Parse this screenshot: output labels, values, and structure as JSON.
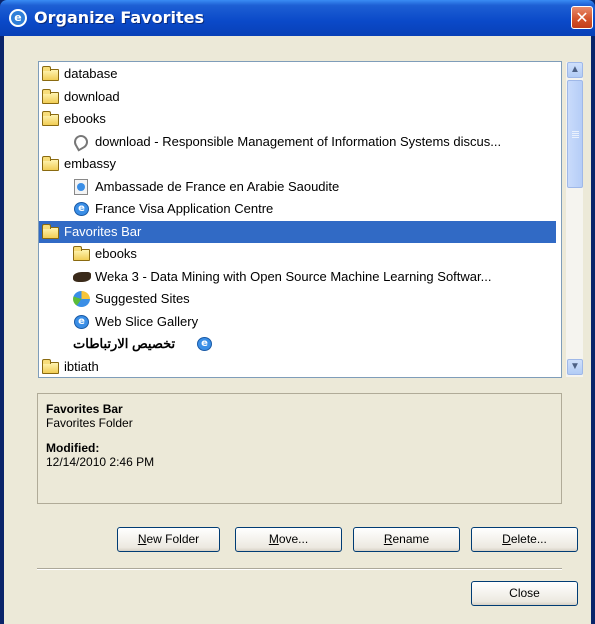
{
  "window": {
    "title": "Organize Favorites",
    "close_glyph": "✕"
  },
  "tree": {
    "items": [
      {
        "label": "database",
        "icon": "folder-icon",
        "indent": 0
      },
      {
        "label": "download",
        "icon": "folder-icon",
        "indent": 0
      },
      {
        "label": "ebooks",
        "icon": "folder-icon",
        "indent": 0
      },
      {
        "label": "download - Responsible Management of Information Systems discus...",
        "icon": "clip-icon",
        "indent": 1
      },
      {
        "label": "embassy",
        "icon": "folder-icon",
        "indent": 0
      },
      {
        "label": "Ambassade de France en Arabie Saoudite",
        "icon": "page-icon",
        "indent": 1
      },
      {
        "label": "France Visa Application Centre",
        "icon": "ie-icon",
        "indent": 1
      },
      {
        "label": "Favorites Bar",
        "icon": "folder-icon",
        "indent": 0,
        "selected": true
      },
      {
        "label": "ebooks",
        "icon": "folder-icon",
        "indent": 1
      },
      {
        "label": "Weka 3 - Data Mining with Open Source Machine Learning Softwar...",
        "icon": "bird-icon",
        "indent": 1
      },
      {
        "label": "Suggested Sites",
        "icon": "suggested-sites-icon",
        "indent": 1
      },
      {
        "label": "Web Slice Gallery",
        "icon": "ie-icon",
        "indent": 1
      },
      {
        "label": "تخصيص الارتباطات",
        "icon": "ie-icon",
        "indent": 1,
        "rtl": true
      },
      {
        "label": "ibtiath",
        "icon": "folder-icon",
        "indent": 0
      }
    ]
  },
  "scrollbar": {
    "up_glyph": "▲",
    "down_glyph": "▼"
  },
  "details": {
    "name": "Favorites Bar",
    "type": "Favorites Folder",
    "modified_label": "Modified:",
    "modified_value": "12/14/2010 2:46 PM"
  },
  "buttons": {
    "new_folder": {
      "accel": "N",
      "rest": "ew Folder"
    },
    "move": {
      "accel": "M",
      "rest": "ove..."
    },
    "rename": {
      "accel": "R",
      "rest": "ename"
    },
    "delete": {
      "accel": "D",
      "rest": "elete..."
    },
    "close": "Close"
  }
}
